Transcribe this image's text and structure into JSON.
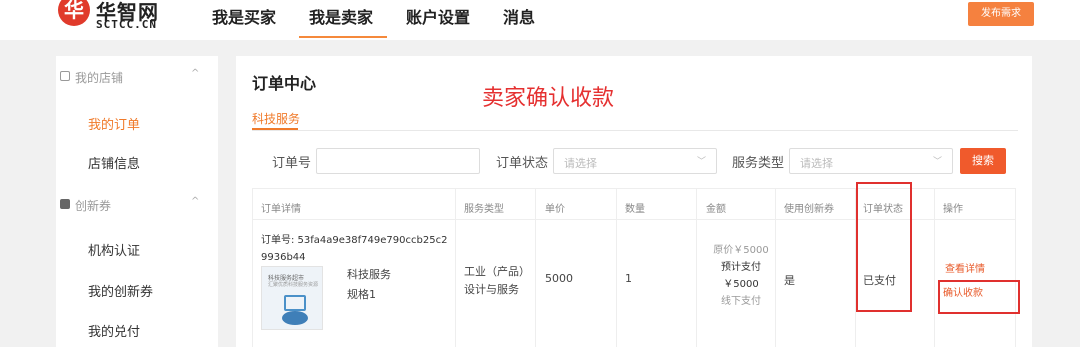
{
  "header": {
    "logo_cn": "华智网",
    "logo_en": "SCTCC.CN",
    "logo_mark": "华",
    "nav": [
      "我是买家",
      "我是卖家",
      "账户设置",
      "消息"
    ],
    "publish_label": "发布需求"
  },
  "sidebar": {
    "groups": [
      {
        "label": "我的店铺",
        "items": [
          "我的订单",
          "店铺信息"
        ]
      },
      {
        "label": "创新券",
        "items": [
          "机构认证",
          "我的创新券",
          "我的兑付"
        ]
      }
    ],
    "chevron": "^"
  },
  "main": {
    "title": "订单中心",
    "annotation": "卖家确认收款",
    "tab": "科技服务",
    "filters": {
      "order_no_label": "订单号",
      "order_no_value": "",
      "status_label": "订单状态",
      "status_placeholder": "请选择",
      "type_label": "服务类型",
      "type_placeholder": "请选择",
      "search_label": "搜索"
    },
    "table": {
      "headers": [
        "订单详情",
        "服务类型",
        "单价",
        "数量",
        "金额",
        "使用创新券",
        "订单状态",
        "操作"
      ],
      "row": {
        "order_no": "订单号: 53fa4a9e38f749e790ccb25c29936b44",
        "thumb_title": "科技服务超市",
        "thumb_sub": "汇聚优质科技服务资源",
        "service_name": "科技服务",
        "spec": "规格1",
        "service_type_1": "工业（产品）",
        "service_type_2": "设计与服务",
        "unit_price": "5000",
        "quantity": "1",
        "original_price": "原价￥5000",
        "expected_pay_label": "预计支付",
        "expected_pay": "￥5000",
        "pay_method": "线下支付",
        "uses_voucher": "是",
        "status": "已支付",
        "op_view": "查看详情",
        "op_confirm": "确认收款"
      }
    }
  },
  "colors": {
    "accent": "#f07a2a",
    "annotation_red": "#e53030",
    "button": "#f05a2c"
  }
}
